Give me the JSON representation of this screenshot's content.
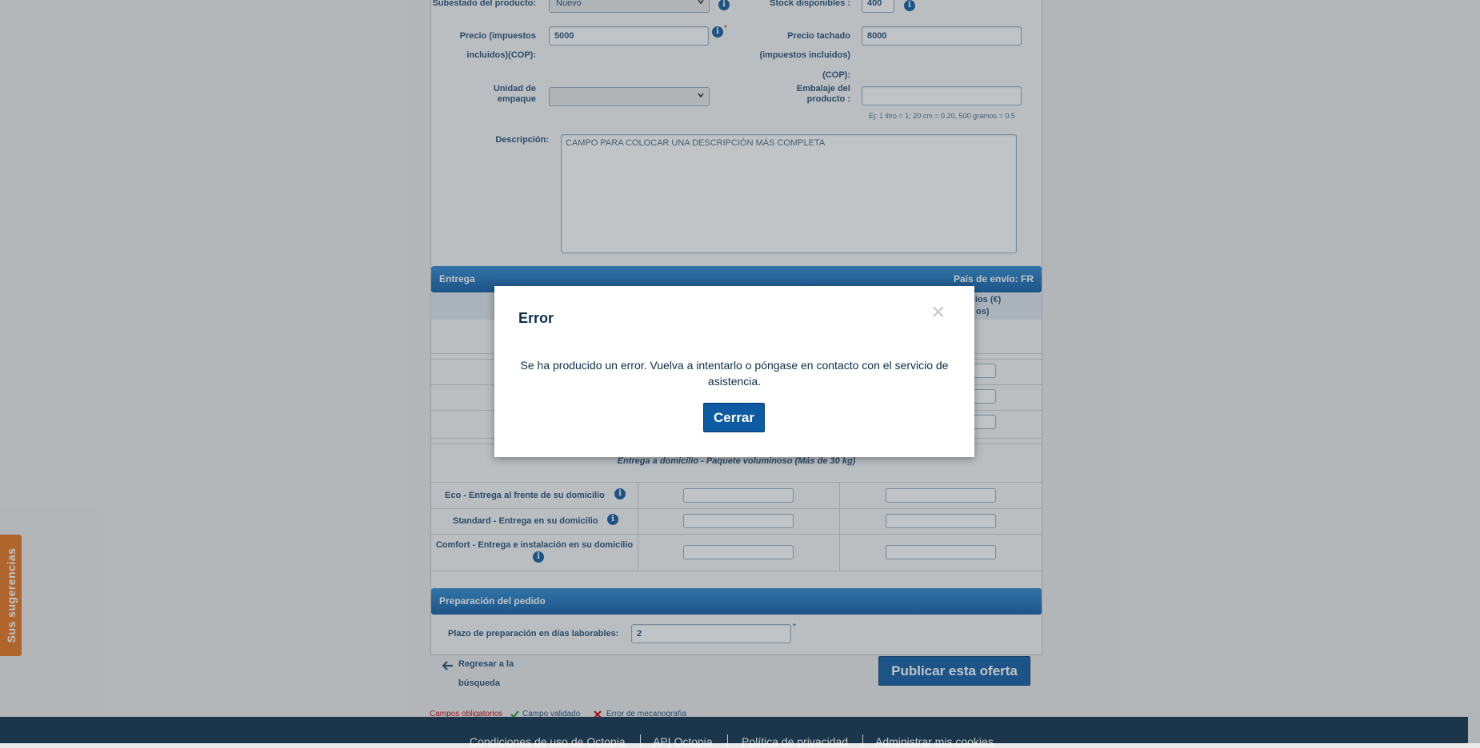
{
  "form": {
    "subestado_label": "Subestado del producto:",
    "subestado_value": "Nuevo",
    "stock_label": "Stock disponibles :",
    "stock_value": "400",
    "precio_label_1": "Precio (impuestos",
    "precio_label_2": "incluidos)(COP):",
    "precio_value": "5000",
    "tachado_label_1": "Precio tachado",
    "tachado_label_2": "(impuestos incluidos)",
    "tachado_label_3": "(COP):",
    "tachado_value": "8000",
    "unidad_label_1": "Unidad de",
    "unidad_label_2": "empaque",
    "unidad_value": "",
    "embalaje_label_1": "Embalaje del",
    "embalaje_label_2": "producto :",
    "embalaje_value": "",
    "embalaje_hint": "Ej: 1 litro = 1; 20 cm = 0.20, 500 gramos = 0.5",
    "descripcion_label": "Descripción:",
    "descripcion_value": "CAMPO PARA COLOCAR UNA DESCRIPCIÓN MÁS COMPLETA",
    "required_mark": "*"
  },
  "entrega": {
    "title": "Entrega",
    "pais": "País de envío: FR",
    "col_header_1": "entarios (€)",
    "col_header_2": "os)",
    "voluminoso_heading": "Entrega a domicilio - Paquete voluminoso (Más de 30 kg)",
    "rows": [
      {
        "label": "Eco - Entrega al frente de su domicilio"
      },
      {
        "label": "Standard - Entrega en su domicilio"
      },
      {
        "label": "Comfort - Entrega e instalación en su domicilio"
      }
    ]
  },
  "preparacion": {
    "title": "Preparación del pedido",
    "plazo_label": "Plazo de preparación en días laborables:",
    "plazo_value": "2",
    "required_mark": "*"
  },
  "actions": {
    "back_line_1": "Regresar a la",
    "back_line_2": "búsqueda",
    "publish": "Publicar esta oferta"
  },
  "legend": {
    "required": "Campos obligatorios",
    "validated": "Campo validado",
    "error": "Error de mecanografía"
  },
  "modal": {
    "title": "Error",
    "message": "Se ha producido un error. Vuelva a intentarlo o póngase en contacto con el servicio de asistencia.",
    "close_button": "Cerrar",
    "close_icon": "×"
  },
  "footer": {
    "links": [
      "Condiciones de uso de Octopia",
      "API Octopia",
      "Política de privacidad",
      "Administrar mis cookies"
    ]
  },
  "feedback_tab": "Sus sugerencias",
  "colors": {
    "primary": "#0e5ba3",
    "footer": "#0c2e48",
    "feedback": "#e8731c",
    "required_red": "#cc0000",
    "valid_green": "#2e9e2e"
  }
}
